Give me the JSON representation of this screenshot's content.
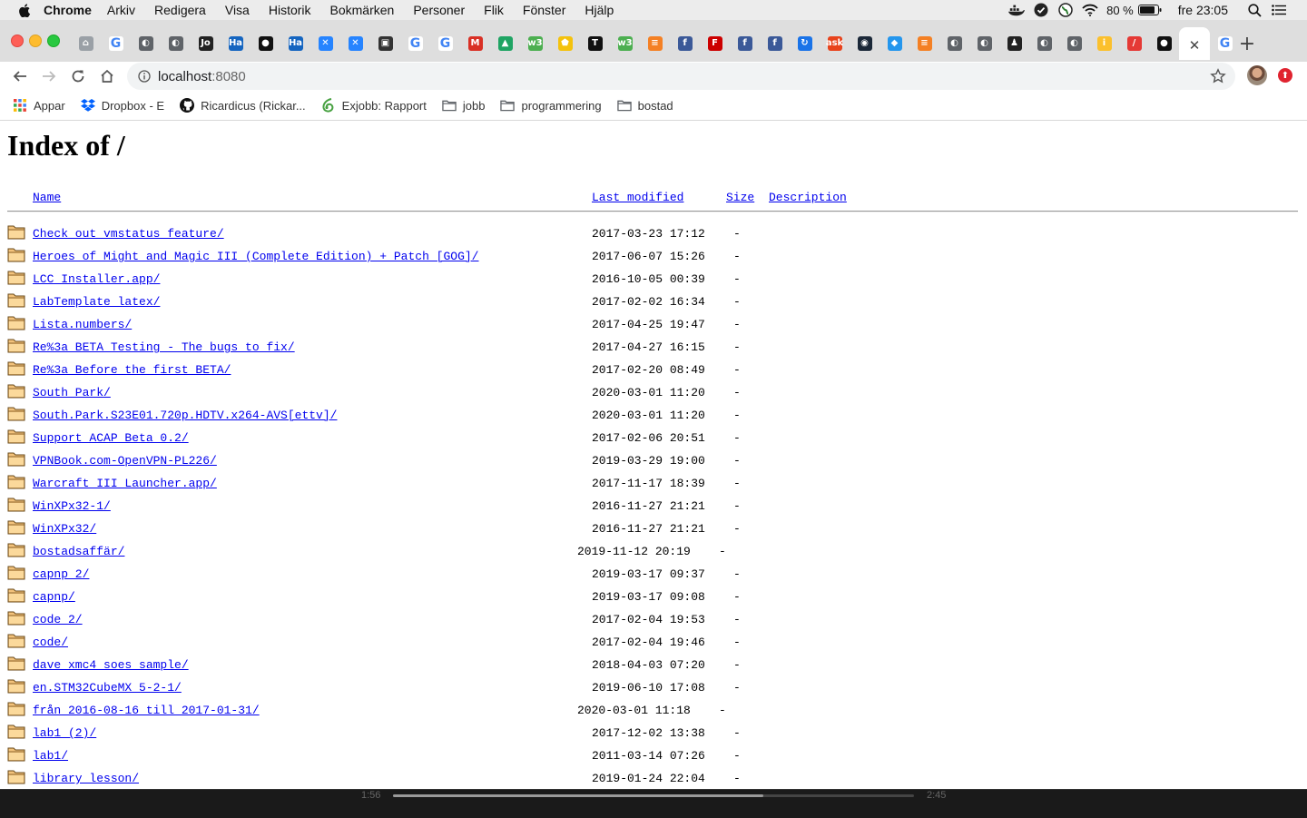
{
  "menubar": {
    "app_name": "Chrome",
    "items": [
      "Arkiv",
      "Redigera",
      "Visa",
      "Historik",
      "Bokmärken",
      "Personer",
      "Flik",
      "Fönster",
      "Hjälp"
    ],
    "battery": "80 %",
    "clock": "fre 23:05"
  },
  "tabs": [
    {
      "icon": "home-icon",
      "color": "#9aa0a6",
      "glyph": "⌂"
    },
    {
      "icon": "google-icon",
      "color": "#4285f4",
      "glyph": "G"
    },
    {
      "icon": "globe-icon",
      "color": "#5f6368",
      "glyph": "◐"
    },
    {
      "icon": "globe-icon",
      "color": "#5f6368",
      "glyph": "◐"
    },
    {
      "icon": "jon-icon",
      "color": "#222222",
      "glyph": "Jo"
    },
    {
      "icon": "ha-icon",
      "color": "#1565c0",
      "glyph": "Ha"
    },
    {
      "icon": "github-icon",
      "color": "#111111",
      "glyph": "●"
    },
    {
      "icon": "ha-icon",
      "color": "#1565c0",
      "glyph": "Ha"
    },
    {
      "icon": "jira-icon",
      "color": "#2684ff",
      "glyph": "✕"
    },
    {
      "icon": "jira-icon",
      "color": "#2684ff",
      "glyph": "✕"
    },
    {
      "icon": "box-icon",
      "color": "#333333",
      "glyph": "▣"
    },
    {
      "icon": "google-icon",
      "color": "#4285f4",
      "glyph": "G"
    },
    {
      "icon": "google-icon",
      "color": "#4285f4",
      "glyph": "G"
    },
    {
      "icon": "gmail-icon",
      "color": "#d93025",
      "glyph": "M"
    },
    {
      "icon": "drive-icon",
      "color": "#1fa463",
      "glyph": "▲"
    },
    {
      "icon": "w3-icon",
      "color": "#4caf50",
      "glyph": "w3"
    },
    {
      "icon": "pentagon-icon",
      "color": "#f4c20d",
      "glyph": "⬟"
    },
    {
      "icon": "nyt-icon",
      "color": "#111111",
      "glyph": "T"
    },
    {
      "icon": "w3-icon",
      "color": "#4caf50",
      "glyph": "w3"
    },
    {
      "icon": "stackoverflow-icon",
      "color": "#f48024",
      "glyph": "≡"
    },
    {
      "icon": "facebook-icon",
      "color": "#3b5998",
      "glyph": "f"
    },
    {
      "icon": "flashback-icon",
      "color": "#cc0000",
      "glyph": "F"
    },
    {
      "icon": "facebook-icon",
      "color": "#3b5998",
      "glyph": "f"
    },
    {
      "icon": "facebook-icon",
      "color": "#3b5998",
      "glyph": "f"
    },
    {
      "icon": "sync-icon",
      "color": "#1a73e8",
      "glyph": "↻"
    },
    {
      "icon": "ask-icon",
      "color": "#e8431c",
      "glyph": "ask"
    },
    {
      "icon": "steam-icon",
      "color": "#1b2838",
      "glyph": "◉"
    },
    {
      "icon": "docker-icon",
      "color": "#2496ed",
      "glyph": "◆"
    },
    {
      "icon": "stackoverflow-icon",
      "color": "#f48024",
      "glyph": "≡"
    },
    {
      "icon": "globe-icon",
      "color": "#5f6368",
      "glyph": "◐"
    },
    {
      "icon": "globe-icon",
      "color": "#5f6368",
      "glyph": "◐"
    },
    {
      "icon": "linux-icon",
      "color": "#222222",
      "glyph": "♟"
    },
    {
      "icon": "globe-icon",
      "color": "#5f6368",
      "glyph": "◐"
    },
    {
      "icon": "globe-icon",
      "color": "#5f6368",
      "glyph": "◐"
    },
    {
      "icon": "info-yellow-icon",
      "color": "#fbc02d",
      "glyph": "i"
    },
    {
      "icon": "pen-icon",
      "color": "#e53935",
      "glyph": "/"
    },
    {
      "icon": "github-icon",
      "color": "#111111",
      "glyph": "●"
    },
    {
      "icon": "close-icon",
      "color": "#ffffff",
      "glyph": "✕",
      "active": true
    },
    {
      "icon": "google-icon",
      "color": "#4285f4",
      "glyph": "G"
    }
  ],
  "new_tab_label": "+",
  "toolbar": {
    "url_host": "localhost",
    "url_port": ":8080"
  },
  "bookmarks": [
    {
      "icon": "apps-grid-icon",
      "label": "Appar"
    },
    {
      "icon": "dropbox-icon",
      "label": "Dropbox - E"
    },
    {
      "icon": "github-icon",
      "label": "Ricardicus (Rickar..."
    },
    {
      "icon": "overleaf-icon",
      "label": "Exjobb: Rapport"
    },
    {
      "icon": "folder-icon",
      "label": "jobb"
    },
    {
      "icon": "folder-icon",
      "label": "programmering"
    },
    {
      "icon": "folder-icon",
      "label": "bostad"
    }
  ],
  "page": {
    "title": "Index of /",
    "headers": {
      "name": "Name",
      "modified": "Last modified",
      "size": "Size",
      "description": "Description"
    },
    "rows": [
      {
        "name": "Check_out_vmstatus_feature/",
        "date": "2017-03-23 17:12",
        "size": "-"
      },
      {
        "name": "Heroes of Might and Magic III (Complete Edition) + Patch [GOG]/",
        "date": "2017-06-07 15:26",
        "size": "-"
      },
      {
        "name": "LCC Installer.app/",
        "date": "2016-10-05 00:39",
        "size": "-"
      },
      {
        "name": "LabTemplate_latex/",
        "date": "2017-02-02 16:34",
        "size": "-"
      },
      {
        "name": "Lista.numbers/",
        "date": "2017-04-25 19:47",
        "size": "-"
      },
      {
        "name": "Re%3a_BETA_Testing_-_The_bugs_to_fix/",
        "date": "2017-04-27 16:15",
        "size": "-"
      },
      {
        "name": "Re%3a_Before_the_first_BETA/",
        "date": "2017-02-20 08:49",
        "size": "-"
      },
      {
        "name": "South Park/",
        "date": "2020-03-01 11:20",
        "size": "-"
      },
      {
        "name": "South.Park.S23E01.720p.HDTV.x264-AVS[ettv]/",
        "date": "2020-03-01 11:20",
        "size": "-"
      },
      {
        "name": "Support_ACAP_Beta_0.2/",
        "date": "2017-02-06 20:51",
        "size": "-"
      },
      {
        "name": "VPNBook.com-OpenVPN-PL226/",
        "date": "2019-03-29 19:00",
        "size": "-"
      },
      {
        "name": "Warcraft III Launcher.app/",
        "date": "2017-11-17 18:39",
        "size": "-"
      },
      {
        "name": "WinXPx32-1/",
        "date": "2016-11-27 21:21",
        "size": "-"
      },
      {
        "name": "WinXPx32/",
        "date": "2016-11-27 21:21",
        "size": "-"
      },
      {
        "name": "bostadsaffär/",
        "date": "2019-11-12 20:19",
        "size": "-",
        "shifted": true
      },
      {
        "name": "capnp 2/",
        "date": "2019-03-17 09:37",
        "size": "-"
      },
      {
        "name": "capnp/",
        "date": "2019-03-17 09:08",
        "size": "-"
      },
      {
        "name": "code 2/",
        "date": "2017-02-04 19:53",
        "size": "-"
      },
      {
        "name": "code/",
        "date": "2017-02-04 19:46",
        "size": "-"
      },
      {
        "name": "dave_xmc4_soes_sample/",
        "date": "2018-04-03 07:20",
        "size": "-"
      },
      {
        "name": "en.STM32CubeMX_5-2-1/",
        "date": "2019-06-10 17:08",
        "size": "-"
      },
      {
        "name": "från 2016-08-16 till 2017-01-31/",
        "date": "2020-03-01 11:18",
        "size": "-",
        "shifted": true
      },
      {
        "name": "lab1 (2)/",
        "date": "2017-12-02 13:38",
        "size": "-"
      },
      {
        "name": "lab1/",
        "date": "2011-03-14 07:26",
        "size": "-"
      },
      {
        "name": "library_lesson/",
        "date": "2019-01-24 22:04",
        "size": "-"
      }
    ]
  },
  "videobar": {
    "elapsed": "1:56",
    "total": "2:45",
    "progress": 0.71
  }
}
